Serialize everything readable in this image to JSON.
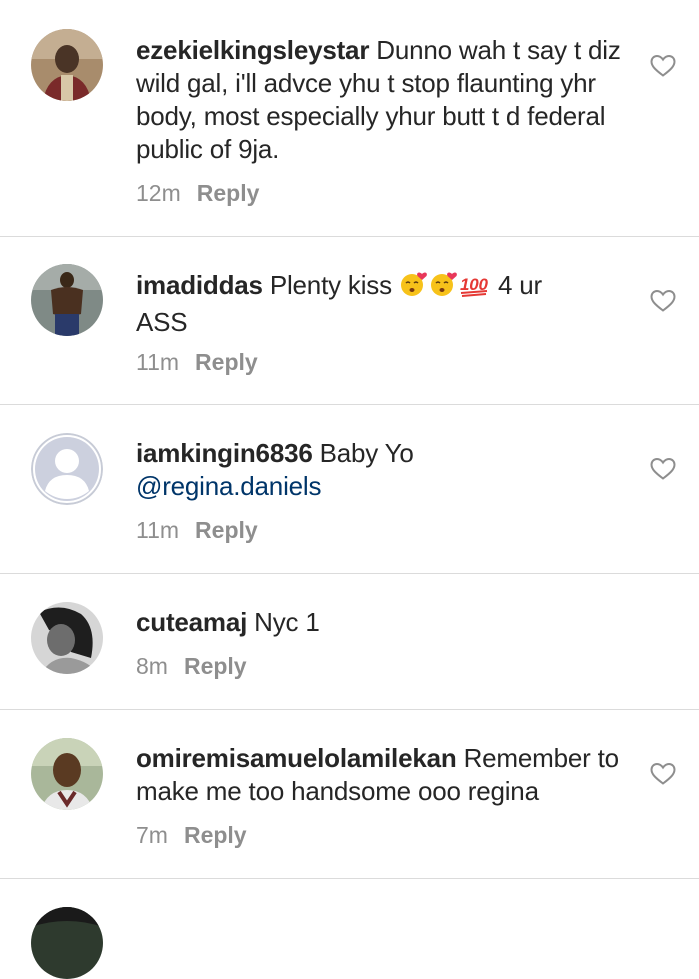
{
  "comments": [
    {
      "username": "ezekielkingsleystar",
      "text": "Dunno wah t say t diz wild gal, i'll advce yhu t stop flaunting yhr body, most especially yhur butt t d federal public of 9ja.",
      "time": "12m",
      "reply_label": "Reply",
      "avatar": "profile-photo"
    },
    {
      "username": "imadiddas",
      "text_before": "Plenty kiss",
      "emojis": [
        "kissing-face-heart-emoji",
        "kissing-face-heart-emoji",
        "hundred-points-emoji"
      ],
      "text_after": "4 ur ASS",
      "time": "11m",
      "reply_label": "Reply",
      "avatar": "profile-photo"
    },
    {
      "username": "iamkingin6836",
      "text": "Baby Yo",
      "mention": "@regina.daniels",
      "time": "11m",
      "reply_label": "Reply",
      "avatar": "default-avatar"
    },
    {
      "username": "cuteamaj",
      "text": "Nyc 1",
      "time": "8m",
      "reply_label": "Reply",
      "avatar": "profile-photo"
    },
    {
      "username": "omiremisamuelolamilekan",
      "text": "Remember to make me too handsome ooo regina",
      "time": "7m",
      "reply_label": "Reply",
      "avatar": "profile-photo"
    }
  ],
  "colors": {
    "username": "#262626",
    "text": "#262626",
    "meta": "#8e8e8e",
    "mention": "#003569",
    "divider": "#dbdbdb"
  }
}
